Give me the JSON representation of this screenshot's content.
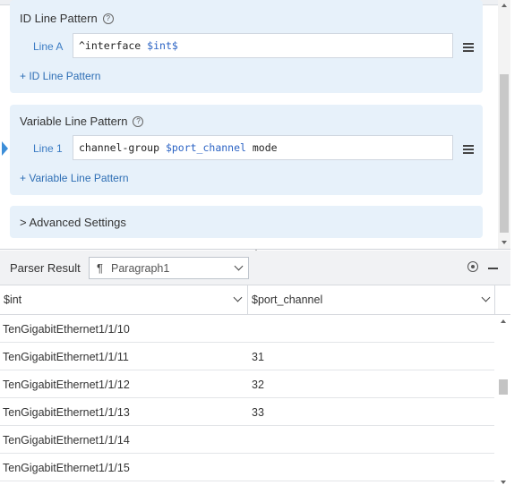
{
  "id_line_pattern": {
    "title": "ID Line Pattern",
    "line_label": "Line A",
    "pattern_prefix": "^interface ",
    "pattern_var": "$int$",
    "add_label": "+ ID Line Pattern"
  },
  "variable_line_pattern": {
    "title": "Variable Line Pattern",
    "line_label": "Line 1",
    "pattern_prefix": "channel-group ",
    "pattern_var": "$port_channel",
    "pattern_suffix": " mode",
    "add_label": "+ Variable Line Pattern"
  },
  "advanced": {
    "label": "> Advanced Settings"
  },
  "parser": {
    "label": "Parser Result",
    "select_icon": "¶",
    "selected": "Paragraph1"
  },
  "table": {
    "columns": [
      "$int",
      "$port_channel"
    ],
    "rows": [
      {
        "int": "TenGigabitEthernet1/1/10",
        "port_channel": ""
      },
      {
        "int": "TenGigabitEthernet1/1/11",
        "port_channel": "31"
      },
      {
        "int": "TenGigabitEthernet1/1/12",
        "port_channel": "32"
      },
      {
        "int": "TenGigabitEthernet1/1/13",
        "port_channel": "33"
      },
      {
        "int": "TenGigabitEthernet1/1/14",
        "port_channel": ""
      },
      {
        "int": "TenGigabitEthernet1/1/15",
        "port_channel": ""
      }
    ]
  },
  "icons": {
    "help": "help-icon",
    "menu": "hamburger-menu-icon",
    "settings": "gear-icon",
    "minimize": "minus-icon"
  },
  "colors": {
    "card_bg": "#e7f1fa",
    "link": "#2f6fb5",
    "variable": "#2b63c4",
    "row_marker": "#3d8ed8"
  }
}
